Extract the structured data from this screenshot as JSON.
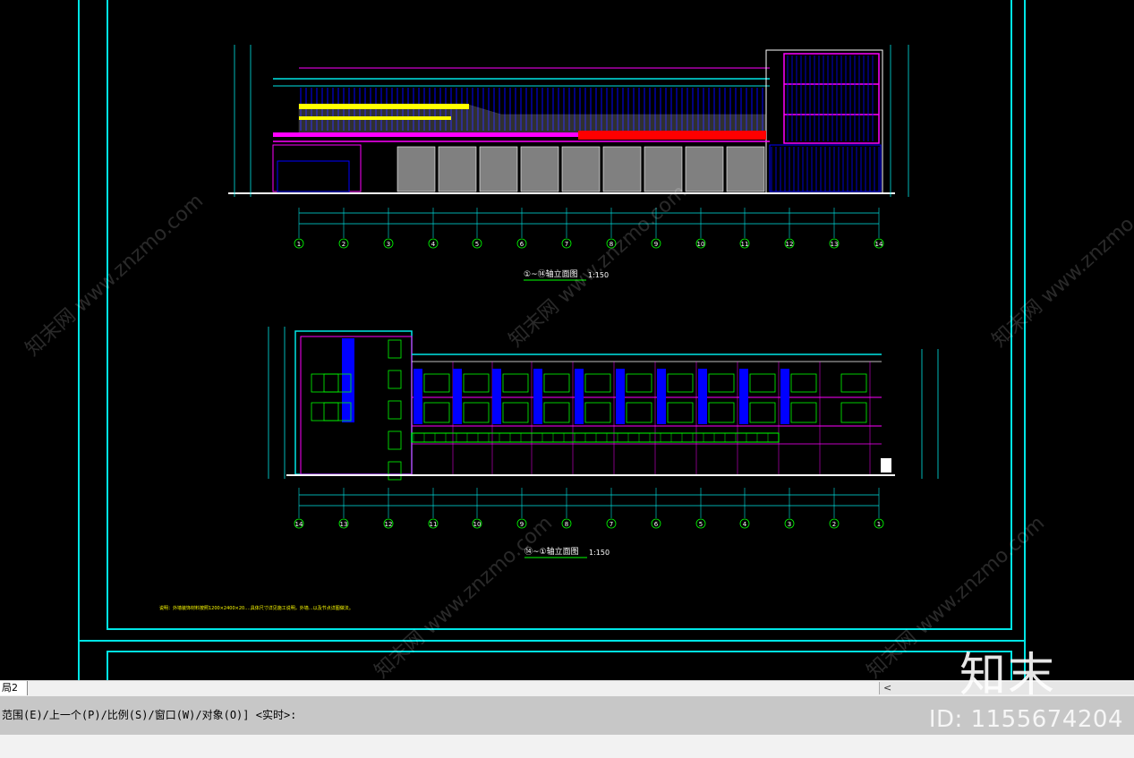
{
  "drawing": {
    "elevation_a": {
      "title": "①~⑭轴立面图",
      "scale": "1:150",
      "axis_labels": [
        "1",
        "2",
        "3",
        "4",
        "5",
        "6",
        "7",
        "8",
        "9",
        "10",
        "11",
        "12",
        "13",
        "14"
      ]
    },
    "elevation_b": {
      "title": "⑭~①轴立面图",
      "scale": "1:150",
      "axis_labels": [
        "14",
        "13",
        "12",
        "11",
        "10",
        "9",
        "8",
        "7",
        "6",
        "5",
        "4",
        "3",
        "2",
        "1"
      ]
    },
    "note": "说明：外墙装饰材料按照1200×2400×20.…具体尺寸详见施工说明，外墙…以及节点详图做法。"
  },
  "ui": {
    "layout_tab": "局2",
    "scroll_left": "<",
    "command_prompt": "范围(E)/上一个(P)/比例(S)/窗口(W)/对象(O)] <实时>:",
    "id_label": "ID: 1155674204",
    "brand_mark": "知末",
    "watermark": "知末网 www.znzmo.com"
  },
  "colors": {
    "frame": "#00e5e5",
    "magenta": "#ff00ff",
    "blue": "#0000ff",
    "yellow": "#ffff00",
    "green": "#00ff00",
    "red": "#ff0000",
    "gray": "#808080",
    "white": "#ffffff"
  }
}
